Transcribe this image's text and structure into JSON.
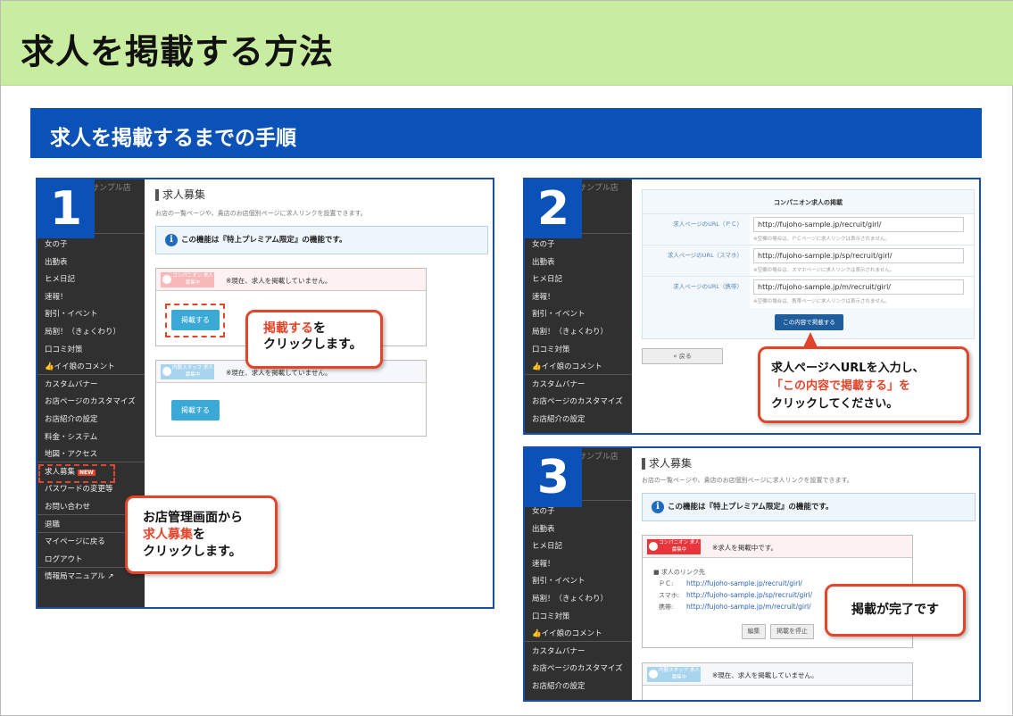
{
  "header": {
    "title": "求人を掲載する方法"
  },
  "section": {
    "title": "求人を掲載するまでの手順"
  },
  "shop_name": "サンプル店",
  "sidebar_full": [
    {
      "label": "女の子"
    },
    {
      "label": "出勤表"
    },
    {
      "label": "ヒメ日記"
    },
    {
      "label": "速報！"
    },
    {
      "label": "割引・イベント"
    },
    {
      "label": "局割！（きょくわり）"
    },
    {
      "label": "口コミ対策"
    },
    {
      "label": "👍イイ娘のコメント",
      "div": true
    },
    {
      "label": "カスタムバナー"
    },
    {
      "label": "お店ページのカスタマイズ"
    },
    {
      "label": "お店紹介の設定"
    },
    {
      "label": "料金・システム"
    },
    {
      "label": "地図・アクセス",
      "div": true
    },
    {
      "label": "求人募集",
      "badge": "NEW"
    },
    {
      "label": "パスワードの変更等"
    },
    {
      "label": "お問い合わせ",
      "div": true
    },
    {
      "label": "退職",
      "div": true
    },
    {
      "label": "マイページに戻る"
    },
    {
      "label": "ログアウト",
      "div": true
    },
    {
      "label": "情報局マニュアル ↗"
    }
  ],
  "sidebar_short": [
    {
      "label": "女の子"
    },
    {
      "label": "出勤表"
    },
    {
      "label": "ヒメ日記"
    },
    {
      "label": "速報！"
    },
    {
      "label": "割引・イベント"
    },
    {
      "label": "局割！（きょくわり）"
    },
    {
      "label": "口コミ対策"
    },
    {
      "label": "👍イイ娘のコメント",
      "div": true
    },
    {
      "label": "カスタムバナー"
    },
    {
      "label": "お店ページのカスタマイズ"
    },
    {
      "label": "お店紹介の設定"
    }
  ],
  "step1": {
    "num": "1",
    "page_title": "求人募集",
    "desc": "お店の一覧ページや、貴店のお店個別ページに求人リンクを設置できます。",
    "info": "この機能は『特上プレミアム限定』の機能です。",
    "companion_badge": "コンパニオン 求人 募集中",
    "companion_status": "※現在、求人を掲載していません。",
    "post_button": "掲載する",
    "staff_badge": "内勤スタッフ 求人 募集中",
    "staff_status": "※現在、求人を掲載していません。",
    "callout_a_red": "掲載する",
    "callout_a_rest": "を",
    "callout_a_line2": "クリックします。",
    "callout_b_line1": "お店管理画面から",
    "callout_b_red": "求人募集",
    "callout_b_rest": "を",
    "callout_b_line3": "クリックします。"
  },
  "step2": {
    "num": "2",
    "form_title": "コンパニオン求人の掲載",
    "rows": [
      {
        "label": "求人ページのURL（ＰＣ）",
        "value": "http://fujoho-sample.jp/recruit/girl/",
        "note": "※空欄の場合は、ＰＣページに求人リンクは表示されません。"
      },
      {
        "label": "求人ページのURL（スマホ）",
        "value": "http://fujoho-sample.jp/sp/recruit/girl/",
        "note": "※空欄の場合は、スマホページに求人リンクは表示されません。"
      },
      {
        "label": "求人ページのURL（携帯）",
        "value": "http://fujoho-sample.jp/m/recruit/girl/",
        "note": "※空欄の場合は、携帯ページに求人リンクは表示されません。"
      }
    ],
    "submit": "この内容で掲載する",
    "back": "« 戻る",
    "callout_line1": "求人ページへURLを入力し、",
    "callout_red": "「この内容で掲載する」を",
    "callout_line3": "クリックしてください。"
  },
  "step3": {
    "num": "3",
    "page_title": "求人募集",
    "desc": "お店の一覧ページや、貴店のお店個別ページに求人リンクを設置できます。",
    "info": "この機能は『特上プレミアム限定』の機能です。",
    "companion_badge": "コンパニオン 求人 募集中",
    "companion_status": "※求人を掲載中です。",
    "links_title": "■ 求人のリンク先",
    "links": [
      {
        "k": "ＰＣ:",
        "v": "http://fujoho-sample.jp/recruit/girl/"
      },
      {
        "k": "スマホ:",
        "v": "http://fujoho-sample.jp/sp/recruit/girl/"
      },
      {
        "k": "携帯:",
        "v": "http://fujoho-sample.jp/m/recruit/girl/"
      }
    ],
    "edit": "編集",
    "stop": "掲載を停止",
    "staff_badge": "内勤スタッフ 求人 募集中",
    "staff_status": "※現在、求人を掲載していません。",
    "callout": "掲載が完了です"
  }
}
